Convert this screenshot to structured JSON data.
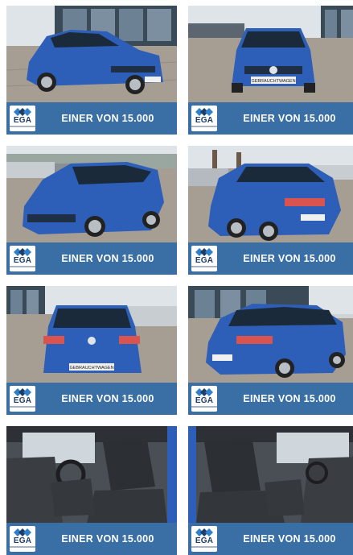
{
  "gallery": {
    "items": [
      {
        "view": "front-left-exterior",
        "logo": "EGA",
        "caption": "EINER VON 15.000",
        "plate": ""
      },
      {
        "view": "front-exterior",
        "logo": "EGA",
        "caption": "EINER VON 15.000",
        "plate": "GEBRAUCHTWAGEN"
      },
      {
        "view": "front-left-exterior",
        "logo": "EGA",
        "caption": "EINER VON 15.000",
        "plate": ""
      },
      {
        "view": "rear-left-exterior",
        "logo": "EGA",
        "caption": "EINER VON 15.000",
        "plate": ""
      },
      {
        "view": "rear-exterior",
        "logo": "EGA",
        "caption": "EINER VON 15.000",
        "plate": "GEBRAUCHTWAGEN"
      },
      {
        "view": "rear-right-exterior",
        "logo": "EGA",
        "caption": "EINER VON 15.000",
        "plate": ""
      },
      {
        "view": "interior-driver",
        "logo": "EGA",
        "caption": "EINER VON 15.000",
        "plate": ""
      },
      {
        "view": "interior-passenger",
        "logo": "EGA",
        "caption": "EINER VON 15.000",
        "plate": ""
      }
    ]
  },
  "colors": {
    "banner": "#3a6fa6",
    "car": "#2d5fb8",
    "sky": "#dfe4e8",
    "pavement": "#a79e93",
    "logo_text": "#1d3c66"
  }
}
